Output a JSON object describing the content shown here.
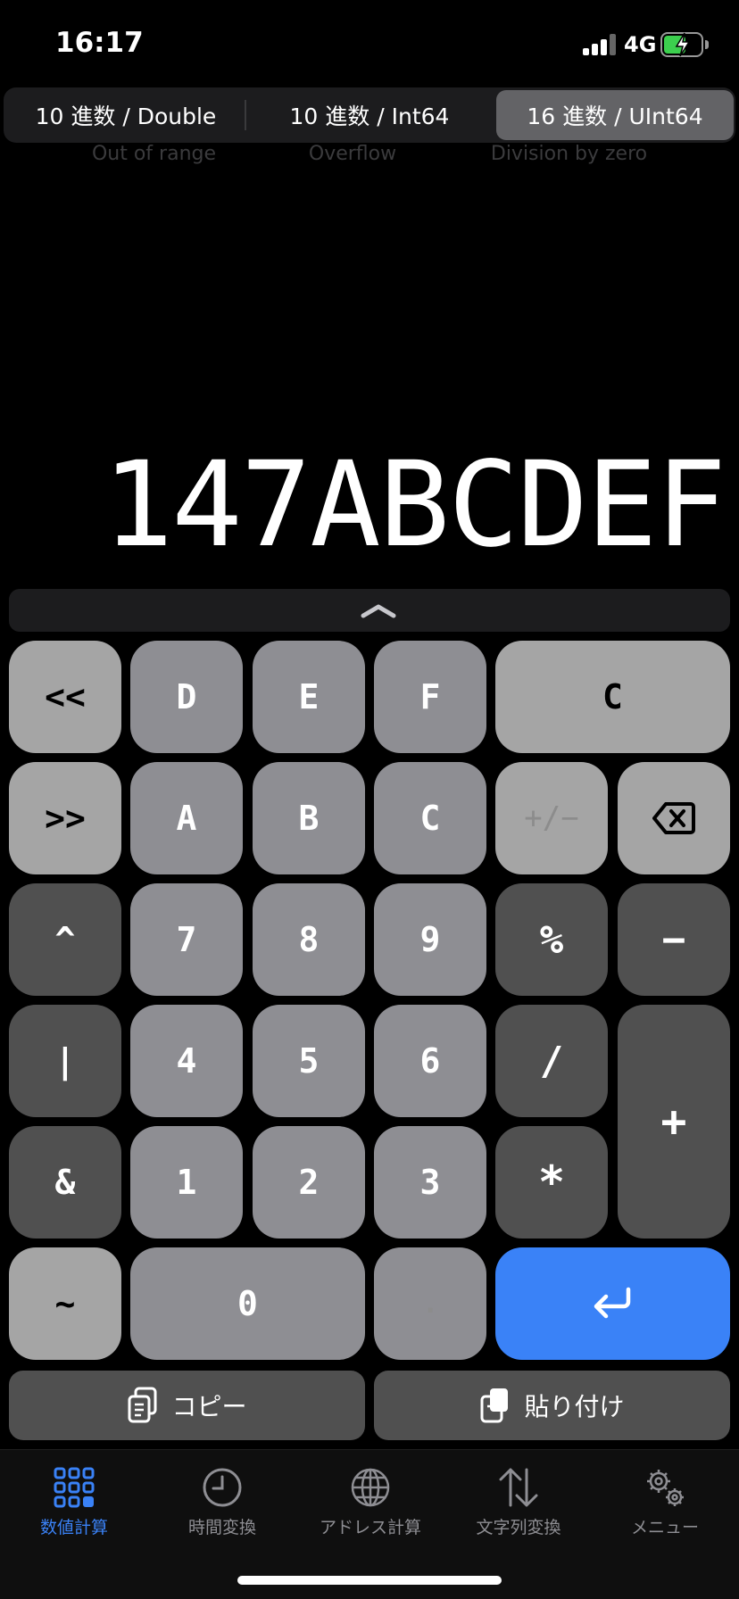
{
  "status_bar": {
    "time": "16:17",
    "network": "4G"
  },
  "modes": [
    {
      "label": "10 進数 / Double",
      "selected": false
    },
    {
      "label": "10 進数 / Int64",
      "selected": false
    },
    {
      "label": "16 進数 / UInt64",
      "selected": true
    }
  ],
  "errors": [
    "Out of range",
    "Overflow",
    "Division by zero"
  ],
  "display": {
    "value": "147ABCDEF"
  },
  "keys": {
    "shift_left": "<<",
    "d": "D",
    "e": "E",
    "f": "F",
    "clear": "C",
    "shift_right": ">>",
    "a": "A",
    "b": "B",
    "c": "C",
    "negate": "+/−",
    "xor": "^",
    "seven": "7",
    "eight": "8",
    "nine": "9",
    "mod": "%",
    "minus": "−",
    "or": "|",
    "four": "4",
    "five": "5",
    "six": "6",
    "divide": "/",
    "plus": "+",
    "and": "&",
    "one": "1",
    "two": "2",
    "three": "3",
    "multiply": "*",
    "not": "~",
    "zero": "0",
    "dot": "."
  },
  "actions": {
    "copy": "コピー",
    "paste": "貼り付け"
  },
  "tabs": [
    {
      "label": "数値計算",
      "icon": "grid-icon",
      "active": true
    },
    {
      "label": "時間変換",
      "icon": "clock-icon",
      "active": false
    },
    {
      "label": "アドレス計算",
      "icon": "globe-icon",
      "active": false
    },
    {
      "label": "文字列変換",
      "icon": "arrows-updown-icon",
      "active": false
    },
    {
      "label": "メニュー",
      "icon": "gears-icon",
      "active": false
    }
  ],
  "colors": {
    "accent": "#3a82f7",
    "battery": "#3ccf4e"
  }
}
